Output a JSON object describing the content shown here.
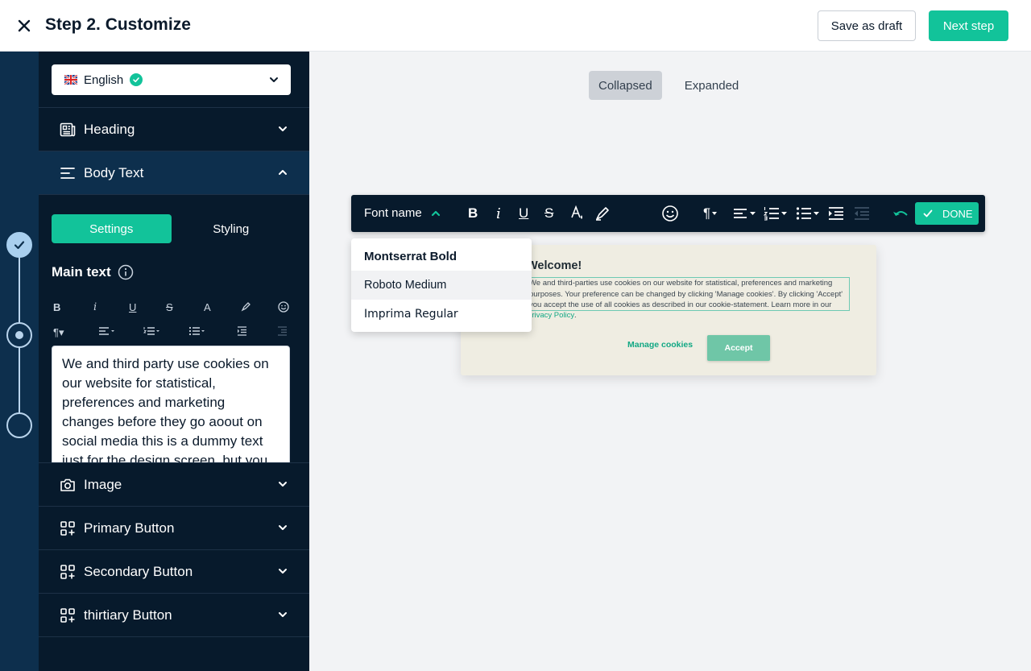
{
  "header": {
    "title": "Step 2. Customize",
    "save_draft_label": "Save as draft",
    "next_step_label": "Next step",
    "close_icon": "close-icon"
  },
  "stepper": {
    "steps": [
      {
        "state": "completed",
        "icon": "check-icon"
      },
      {
        "state": "current"
      },
      {
        "state": "pending"
      }
    ]
  },
  "sidebar": {
    "language": {
      "label": "English",
      "flag": "uk-flag-icon",
      "verified_icon": "check-circle-icon"
    },
    "sections": [
      {
        "label": "Heading",
        "icon": "heading-icon",
        "open": false
      },
      {
        "label": "Body Text",
        "icon": "text-align-icon",
        "open": true
      },
      {
        "label": "Image",
        "icon": "camera-icon",
        "open": false
      },
      {
        "label": "Primary Button",
        "icon": "apps-add-icon",
        "open": false
      },
      {
        "label": "Secondary Button",
        "icon": "apps-add-icon",
        "open": false
      },
      {
        "label": "thirtiary Button",
        "icon": "apps-add-icon",
        "open": false
      }
    ],
    "body_text": {
      "tabs": [
        "Settings",
        "Styling"
      ],
      "active_tab": "Settings",
      "main_text_label": "Main text",
      "content": "We and third party use cookies on our website for statistical, preferences and marketing changes before they go aoout on social media this is a dummy text just for the design screen, but you"
    }
  },
  "canvas": {
    "view_tabs": [
      "Collapsed",
      "Expanded"
    ],
    "active_view": "Collapsed",
    "toolbar": {
      "font_name_label": "Font name",
      "done_label": "DONE"
    },
    "font_menu": {
      "options": [
        "Montserrat Bold",
        "Roboto Medium",
        "Imprima Regular"
      ],
      "hovered": "Roboto Medium"
    },
    "banner": {
      "title": "Welcome!",
      "text": "We and third-parties use cookies on our website for statistical, preferences and marketing purposes. Your preference can be changed by clicking 'Manage cookies'. By clicking 'Accept' you accept the use of all cookies as described in our cookie-statement. Learn more in our",
      "link_label": "Privacy Policy",
      "link_suffix": ".",
      "manage_label": "Manage cookies",
      "accept_label": "Accept"
    }
  },
  "colors": {
    "accent": "#12c39a",
    "sidebar_bg": "#071a2c",
    "rail_bg": "#0d2f4d",
    "banner_bg": "#efede2"
  }
}
